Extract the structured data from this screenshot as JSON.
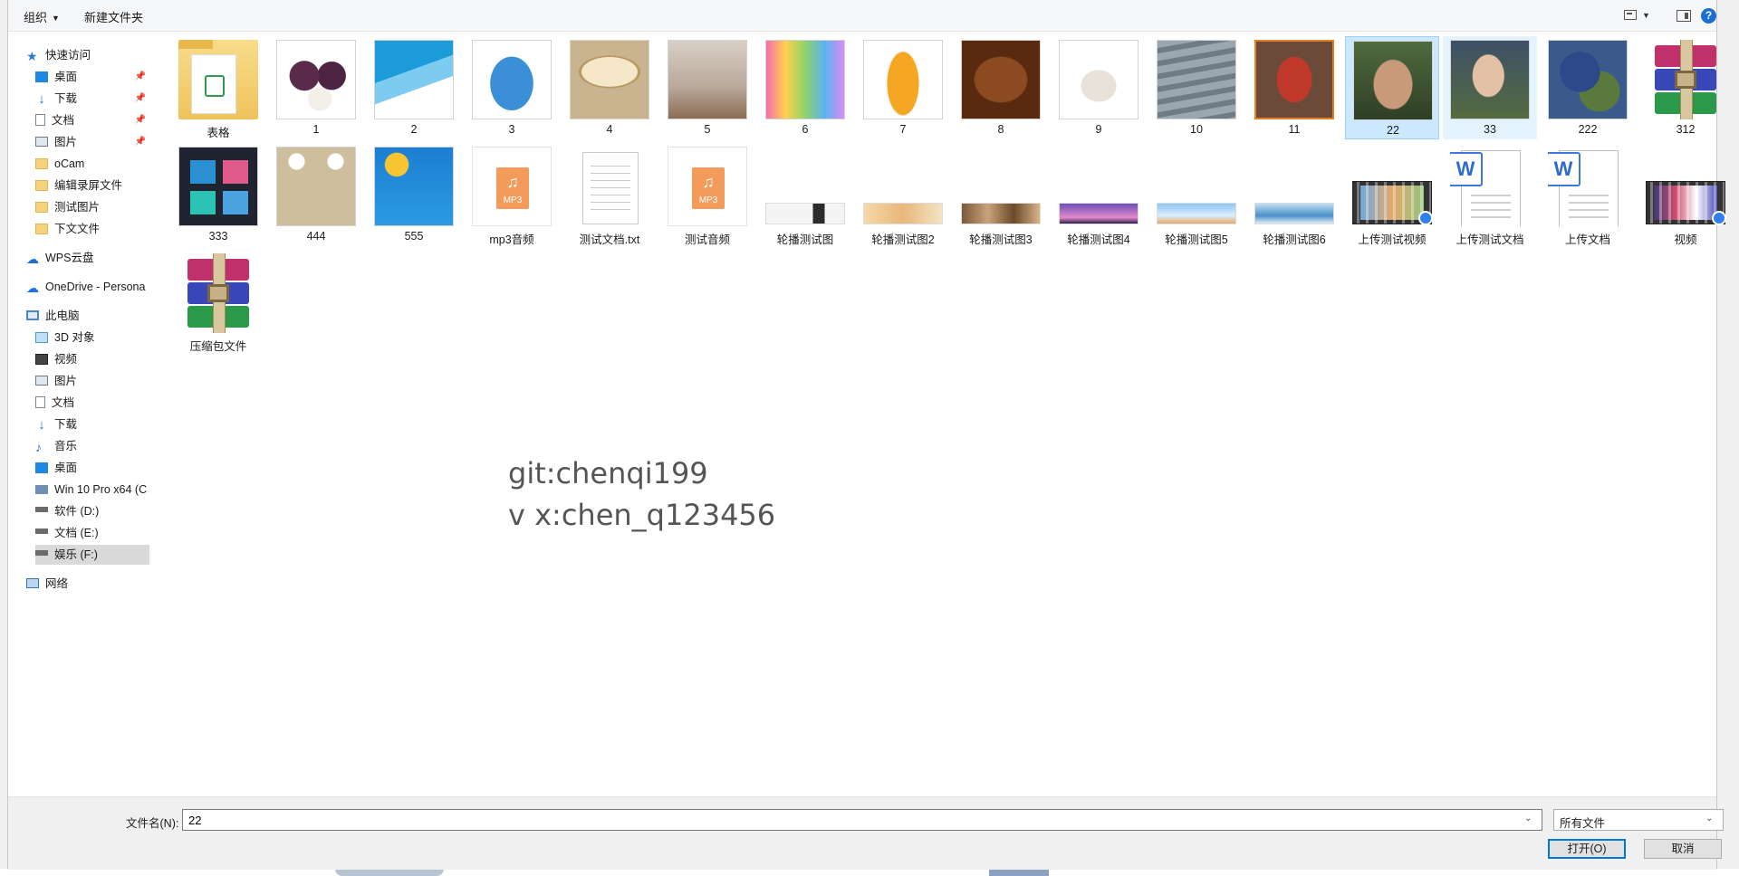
{
  "toolbar": {
    "organize": "组织",
    "new_folder": "新建文件夹",
    "help": "?"
  },
  "sidebar": {
    "quick_access": "快速访问",
    "quick_items": [
      "桌面",
      "下载",
      "文档",
      "图片",
      "oCam",
      "编辑录屏文件",
      "测试图片",
      "下文文件"
    ],
    "wps": "WPS云盘",
    "onedrive": "OneDrive - Persona",
    "this_pc": "此电脑",
    "pc_items": [
      "3D 对象",
      "视频",
      "图片",
      "文档",
      "下载",
      "音乐",
      "桌面",
      "Win 10 Pro x64 (C",
      "软件 (D:)",
      "文档 (E:)",
      "娱乐 (F:)"
    ],
    "network": "网络"
  },
  "files": [
    "表格",
    "1",
    "2",
    "3",
    "4",
    "5",
    "6",
    "7",
    "8",
    "9",
    "10",
    "11",
    "22",
    "33",
    "222",
    "312",
    "333",
    "444",
    "555",
    "mp3音频",
    "测试文档.txt",
    "测试音频",
    "轮播测试图",
    "轮播测试图2",
    "轮播测试图3",
    "轮播测试图4",
    "轮播测试图5",
    "轮播测试图6",
    "上传测试视频",
    "上传测试文档",
    "上传文档",
    "视频",
    "压缩包文件"
  ],
  "icons": {
    "mp3": "MP3",
    "word": "W"
  },
  "watermark": {
    "line1": "git:chenqi199",
    "line2": "v x:chen_q123456"
  },
  "bottom": {
    "filename_label": "文件名(N):",
    "filename_value": "22",
    "filetype": "所有文件",
    "open": "打开(O)",
    "cancel": "取消"
  },
  "colors": {
    "accent": "#0078d7",
    "selected_bg": "#cce8ff",
    "selected_border": "#99d1ff",
    "hover_bg": "#e5f3ff"
  }
}
